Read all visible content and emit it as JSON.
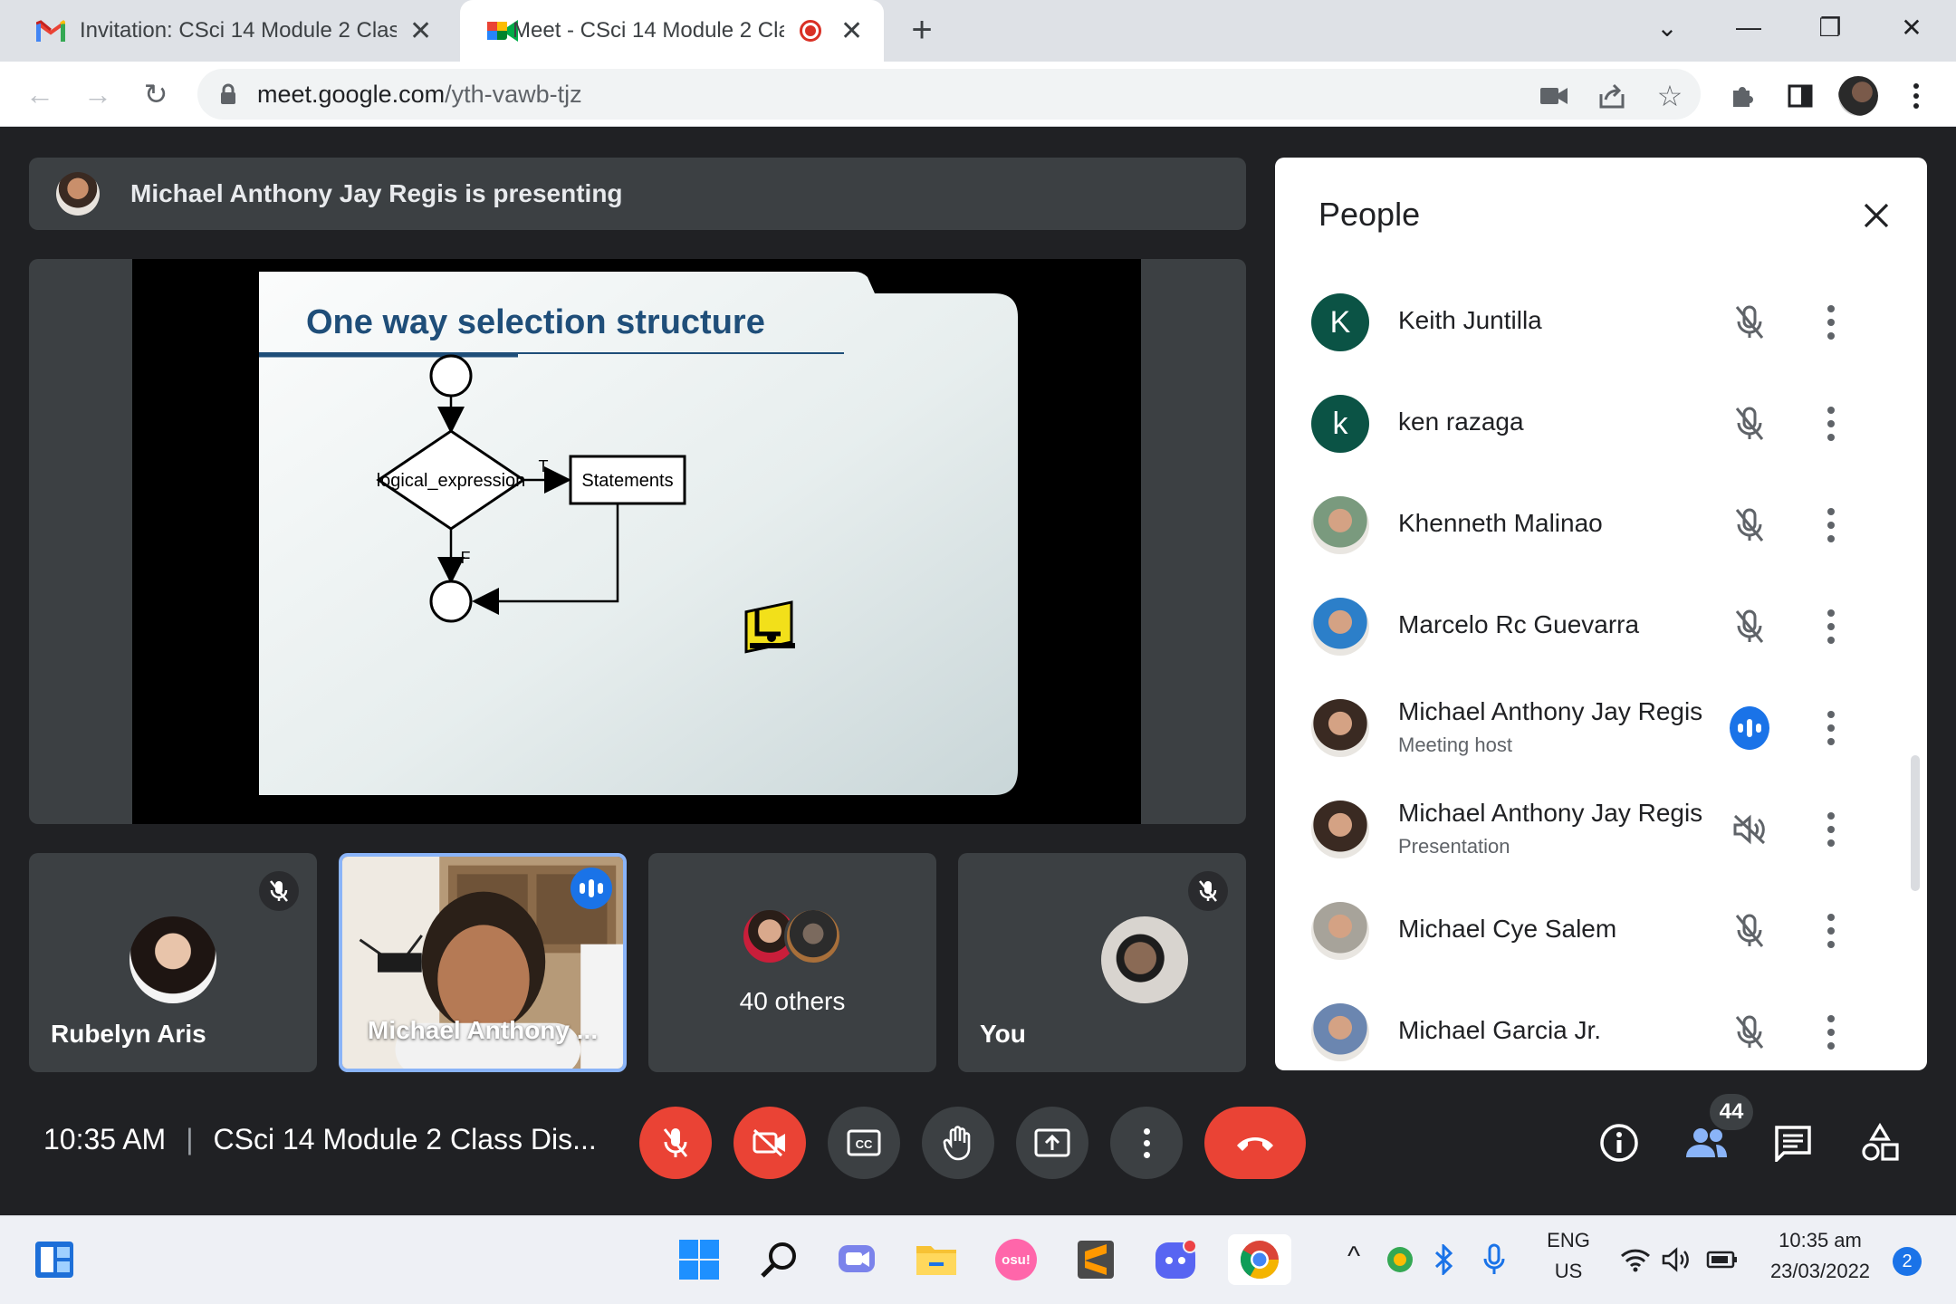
{
  "browser": {
    "tabs": [
      {
        "title": "Invitation: CSci 14 Module 2 Clas",
        "icon": "gmail-icon"
      },
      {
        "title": "Meet - CSci 14 Module 2 Cla",
        "icon": "meet-icon",
        "recording": true
      }
    ],
    "new_tab_label": "+",
    "url_host": "meet.google.com",
    "url_path": "/yth-vawb-tjz"
  },
  "meet": {
    "presenting_text": "Michael Anthony Jay Regis is presenting",
    "slide": {
      "title": "One way selection structure",
      "decision_label": "logical_expression",
      "process_label": "Statements",
      "true_label": "T",
      "false_label": "F"
    },
    "tiles": [
      {
        "name": "Rubelyn Aris",
        "muted": true
      },
      {
        "name": "Michael Anthony ...",
        "speaking": true
      },
      {
        "label": "40 others"
      },
      {
        "name": "You",
        "muted": true
      }
    ],
    "time": "10:35 AM",
    "meeting_title": "CSci 14 Module 2 Class Dis...",
    "people_count": "44"
  },
  "people_panel": {
    "title": "People",
    "participants": [
      {
        "name": "Keith Juntilla",
        "initial": "K",
        "avatar_color": "#0b5345",
        "status": "muted"
      },
      {
        "name": "ken razaga",
        "initial": "k",
        "avatar_color": "#0b5345",
        "status": "muted"
      },
      {
        "name": "Khenneth Malinao",
        "initial": "",
        "avatar_color": "#7a9a7e",
        "status": "muted"
      },
      {
        "name": "Marcelo Rc Guevarra",
        "initial": "",
        "avatar_color": "#2c7fc9",
        "status": "muted"
      },
      {
        "name": "Michael Anthony Jay Regis",
        "subtitle": "Meeting host",
        "initial": "",
        "avatar_color": "#3a2a22",
        "status": "speaking"
      },
      {
        "name": "Michael Anthony Jay Regis",
        "subtitle": "Presentation",
        "initial": "",
        "avatar_color": "#3a2a22",
        "status": "audio-off"
      },
      {
        "name": "Michael Cye Salem",
        "initial": "",
        "avatar_color": "#a7a39a",
        "status": "muted"
      },
      {
        "name": "Michael Garcia Jr.",
        "initial": "",
        "avatar_color": "#6b86b0",
        "status": "muted"
      }
    ]
  },
  "taskbar": {
    "language": "ENG",
    "region": "US",
    "clock_time": "10:35 am",
    "clock_date": "23/03/2022",
    "notification_count": "2",
    "osu_label": "osu!"
  },
  "colors": {
    "meet_bg": "#202124",
    "tile_bg": "#3c4043",
    "danger": "#ea4335",
    "speaking_blue": "#1a73e8",
    "slide_title": "#1f4e79"
  }
}
